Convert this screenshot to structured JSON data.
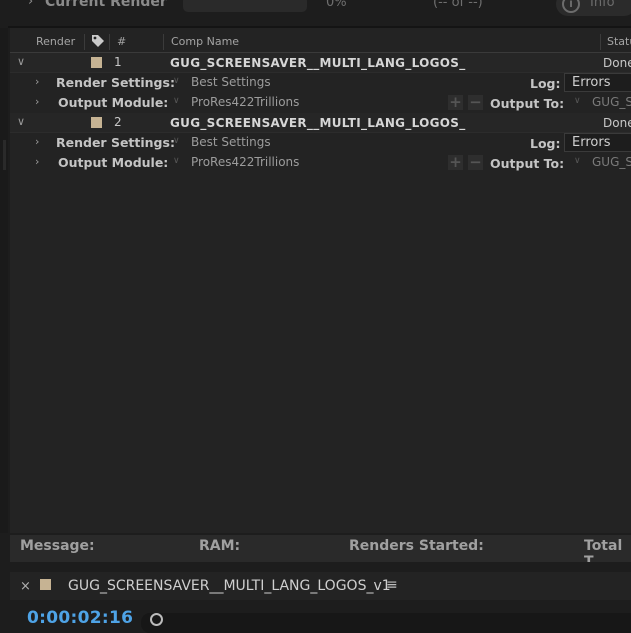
{
  "current_render": {
    "label": "Current Render",
    "percent": "0%",
    "of_count": "(-- of --)",
    "info_label": "Info"
  },
  "columns": {
    "render": "Render",
    "number": "#",
    "comp_name": "Comp Name",
    "status": "Status"
  },
  "queue": [
    {
      "number": "1",
      "comp_name": "GUG_SCREENSAVER__MULTI_LANG_LOGOS_",
      "status": "Done",
      "render_settings_label": "Render Settings:",
      "render_settings_value": "Best Settings",
      "log_label": "Log:",
      "log_value": "Errors Only",
      "output_module_label": "Output Module:",
      "output_module_value": "ProRes422Trillions",
      "output_to_label": "Output To:",
      "output_to_value": "GUG_S"
    },
    {
      "number": "2",
      "comp_name": "GUG_SCREENSAVER__MULTI_LANG_LOGOS_",
      "status": "Done",
      "render_settings_label": "Render Settings:",
      "render_settings_value": "Best Settings",
      "log_label": "Log:",
      "log_value": "Errors Only",
      "output_module_label": "Output Module:",
      "output_module_value": "ProRes422Trillions",
      "output_to_label": "Output To:",
      "output_to_value": "GUG_S"
    }
  ],
  "message_bar": {
    "message": "Message:",
    "ram": "RAM:",
    "renders_started": "Renders Started:",
    "total_time": "Total T"
  },
  "timeline": {
    "tab_title": "GUG_SCREENSAVER__MULTI_LANG_LOGOS_v1",
    "timecode": "0:00:02:16"
  },
  "colors": {
    "label_swatch": "#c6b393",
    "timecode": "#4ea3e6"
  }
}
